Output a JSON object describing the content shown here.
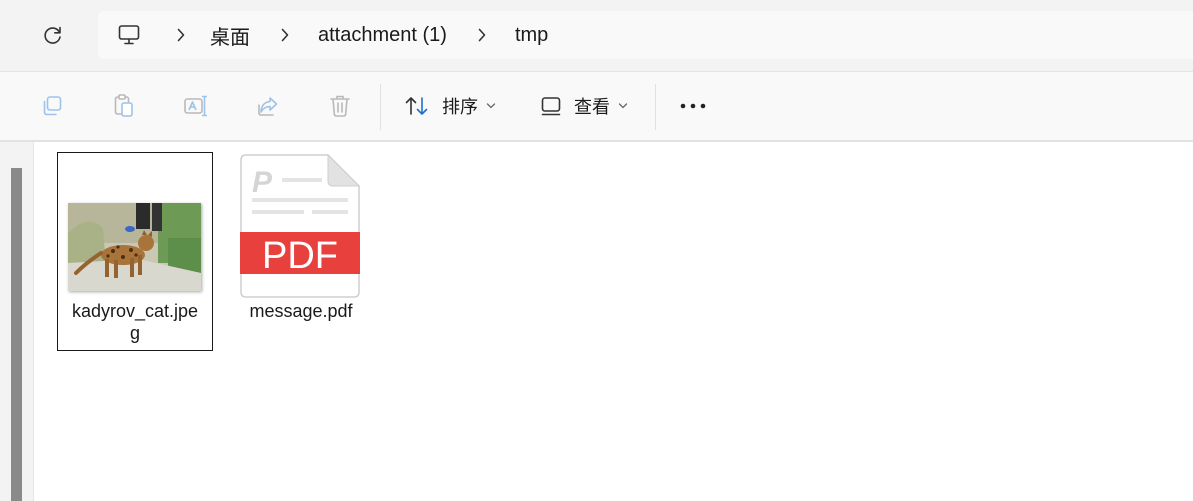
{
  "address_bar": {
    "refresh_icon": "refresh-icon",
    "root_icon": "this-pc-icon",
    "breadcrumbs": [
      "桌面",
      "attachment (1)",
      "tmp"
    ]
  },
  "command_bar": {
    "copy_icon": "copy-icon",
    "paste_icon": "paste-icon",
    "rename_icon": "rename-icon",
    "share_icon": "share-icon",
    "delete_icon": "delete-icon",
    "sort_label": "排序",
    "view_label": "查看",
    "more_icon": "more-icon"
  },
  "files": [
    {
      "name": "kadyrov_cat.jpe\ng",
      "type": "image",
      "selected": true
    },
    {
      "name": "message.pdf",
      "type": "pdf",
      "selected": false
    }
  ],
  "pdf_badge": "PDF",
  "colors": {
    "pdf_red": "#e8413d",
    "accent_blue": "#1f6fd0",
    "disabled_icon": "#9cc3ea"
  }
}
